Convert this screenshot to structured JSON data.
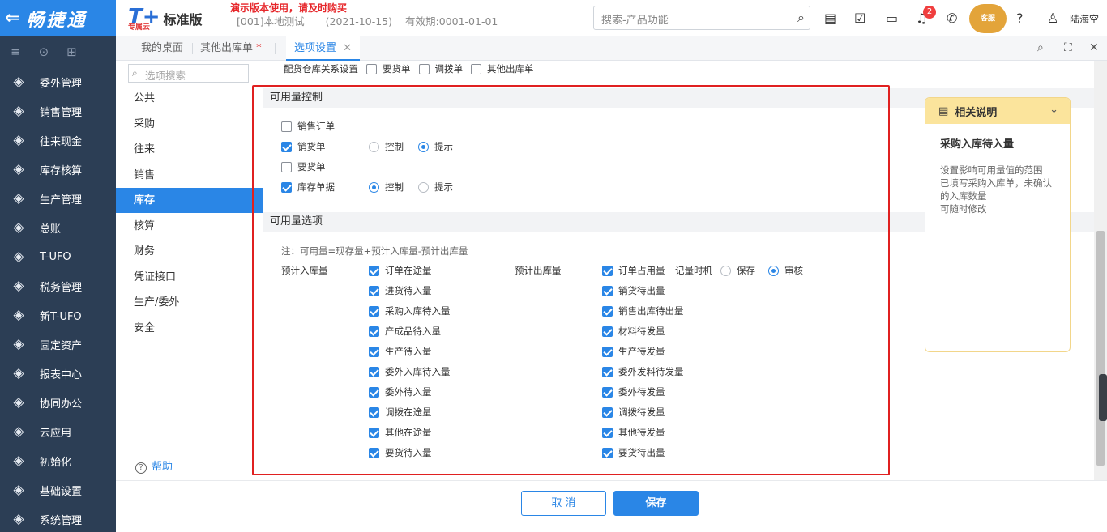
{
  "topbar": {
    "brand": "畅捷通",
    "product_logo": "T+",
    "product_sub": "专属云",
    "edition": "标准版",
    "notice": "演示版本使用，请及时购买",
    "account": "[001]本地测试",
    "date": "(2021-10-15)",
    "validity": "有效期:0001-01-01",
    "search_placeholder": "搜索-产品功能",
    "notification_count": "2",
    "mascot_label": "客服",
    "user_name": "陆海空"
  },
  "sidebar": {
    "items": [
      {
        "label": "委外管理",
        "icon": "outsource-icon"
      },
      {
        "label": "销售管理",
        "icon": "sales-chart-icon"
      },
      {
        "label": "往来现金",
        "icon": "exchange-icon"
      },
      {
        "label": "库存核算",
        "icon": "inventory-icon"
      },
      {
        "label": "生产管理",
        "icon": "production-icon"
      },
      {
        "label": "总账",
        "icon": "ledger-icon"
      },
      {
        "label": "T-UFO",
        "icon": "ufo-icon"
      },
      {
        "label": "税务管理",
        "icon": "tax-icon"
      },
      {
        "label": "新T-UFO",
        "icon": "new-ufo-icon"
      },
      {
        "label": "固定资产",
        "icon": "bank-icon"
      },
      {
        "label": "报表中心",
        "icon": "pie-chart-icon"
      },
      {
        "label": "协同办公",
        "icon": "collaboration-icon"
      },
      {
        "label": "云应用",
        "icon": "cloud-icon"
      },
      {
        "label": "初始化",
        "icon": "refresh-icon"
      },
      {
        "label": "基础设置",
        "icon": "settings-icon"
      },
      {
        "label": "系统管理",
        "icon": "system-icon"
      }
    ]
  },
  "tabs": {
    "desktop": "我的桌面",
    "other_out": "其他出库单",
    "other_out_star": "*",
    "options": "选项设置"
  },
  "optnav": {
    "search_placeholder": "选项搜索",
    "items": [
      "公共",
      "采购",
      "往来",
      "销售",
      "库存",
      "核算",
      "财务",
      "凭证接口",
      "生产/委外",
      "安全"
    ],
    "selected": "库存",
    "help": "帮助"
  },
  "main": {
    "top_row": {
      "label": "配货仓库关系设置",
      "options": [
        "要货单",
        "调拨单",
        "其他出库单"
      ]
    },
    "control_section": {
      "title": "可用量控制",
      "rows": [
        {
          "label": "销售订单",
          "checked": false
        },
        {
          "label": "销货单",
          "checked": true,
          "radio": [
            "控制",
            "提示"
          ],
          "selected": "提示"
        },
        {
          "label": "要货单",
          "checked": false
        },
        {
          "label": "库存单据",
          "checked": true,
          "radio": [
            "控制",
            "提示"
          ],
          "selected": "控制"
        }
      ]
    },
    "options_section": {
      "title": "可用量选项",
      "note": "注：可用量=现存量+预计入库量-预计出库量",
      "in_label": "预计入库量",
      "in_items": [
        "订单在途量",
        "进货待入量",
        "采购入库待入量",
        "产成品待入量",
        "生产待入量",
        "委外入库待入量",
        "委外待入量",
        "调拨在途量",
        "其他在途量",
        "要货待入量"
      ],
      "out_label": "预计出库量",
      "out_items": [
        "订单占用量",
        "销货待出量",
        "销售出库待出量",
        "材料待发量",
        "生产待发量",
        "委外发料待发量",
        "委外待发量",
        "调拨待发量",
        "其他待发量",
        "要货待出量"
      ],
      "record_time_label": "记量时机",
      "record_time_options": [
        "保存",
        "审核"
      ],
      "record_time_selected": "审核"
    }
  },
  "info_panel": {
    "header": "相关说明",
    "title": "采购入库待入量",
    "lines": [
      "设置影响可用量值的范围",
      "已填写采购入库单，未确认的入库数量",
      "可随时修改"
    ]
  },
  "footer": {
    "cancel": "取 消",
    "save": "保存"
  },
  "colors": {
    "primary": "#2a86e6",
    "sidebar": "#2c3e55",
    "highlight_border": "#e02020",
    "info_header": "#fbe49c"
  }
}
